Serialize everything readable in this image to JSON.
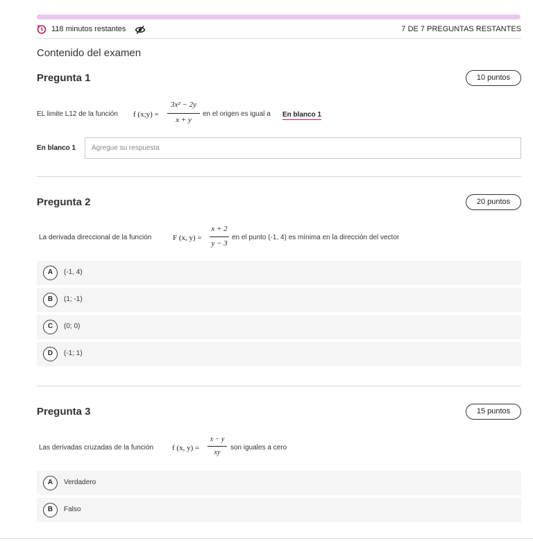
{
  "header": {
    "timer_text": "118 minutos restantes",
    "remaining_text": "7 DE 7 PREGUNTAS RESTANTES",
    "progress_color": "#e9c8ee",
    "timer_icon": "timer-icon",
    "hide_icon": "eye-slash-icon"
  },
  "section_title": "Contenido del examen",
  "questions": [
    {
      "title": "Pregunta 1",
      "points": "10 puntos",
      "text_before": "EL limite L12 de la función",
      "function_lhs": "f (x;y) =",
      "numerator": "3x² − 2y",
      "denominator": "x + y",
      "text_after": "en el origen es igual a",
      "blank_link": "En blanco 1",
      "blank_label": "En blanco 1",
      "input_placeholder": "Agregue su respuesta",
      "input_value": ""
    },
    {
      "title": "Pregunta 2",
      "points": "20 puntos",
      "text_before": "La derivada direccional de la función",
      "function_lhs": "F (x, y) =",
      "numerator": "x + 2",
      "denominator": "y − 3",
      "text_after": "en el punto (-1, 4) es mínima en la dirección del vector",
      "options": [
        {
          "letter": "A",
          "text": "(-1, 4)"
        },
        {
          "letter": "B",
          "text": "(1; -1)"
        },
        {
          "letter": "C",
          "text": "(0; 0)"
        },
        {
          "letter": "D",
          "text": "(-1; 1)"
        }
      ]
    },
    {
      "title": "Pregunta 3",
      "points": "15 puntos",
      "text_before": "Las derivadas cruzadas de la función",
      "function_lhs": "f (x, y) =",
      "numerator": "x − y",
      "denominator": "xy",
      "text_after": "son iguales a cero",
      "options": [
        {
          "letter": "A",
          "text": "Verdadero"
        },
        {
          "letter": "B",
          "text": "Falso"
        }
      ]
    }
  ]
}
